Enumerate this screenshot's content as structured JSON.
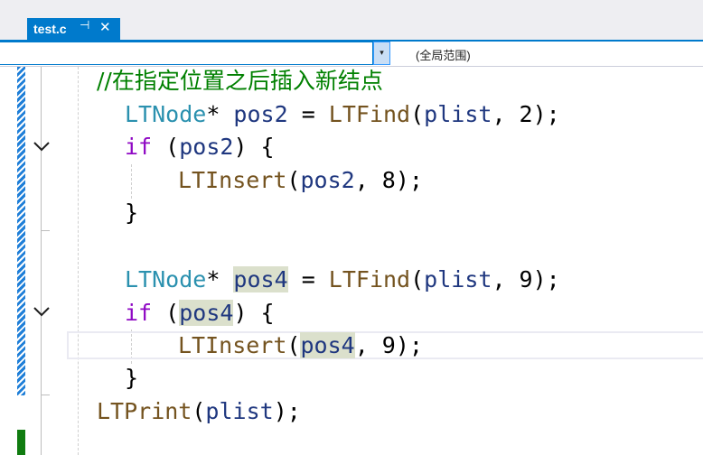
{
  "tab": {
    "filename": "test.c",
    "pin_glyph": "⊣",
    "close_glyph": "✕"
  },
  "navbar": {
    "left_value": "",
    "dropdown_glyph": "▾",
    "scope": "(全局范围)"
  },
  "code": {
    "comment": "//在指定位置之后插入新结点",
    "l1": {
      "type": "LTNode",
      "star": "* ",
      "var": "pos2",
      "eq": " = ",
      "fn": "LTFind",
      "open": "(",
      "arg": "plist",
      "rest": ", 2);"
    },
    "l2": {
      "kw": "if",
      "open": " (",
      "var": "pos2",
      "close": ") {"
    },
    "l3": {
      "fn": "LTInsert",
      "open": "(",
      "var": "pos2",
      "rest": ", 8);"
    },
    "l4": {
      "brace": "}"
    },
    "l6": {
      "type": "LTNode",
      "star": "* ",
      "var": "pos4",
      "eq": " = ",
      "fn": "LTFind",
      "open": "(",
      "arg": "plist",
      "rest": ", 9);"
    },
    "l7": {
      "kw": "if",
      "open": " (",
      "var": "pos4",
      "close": ") {"
    },
    "l8": {
      "fn": "LTInsert",
      "open": "(",
      "var": "pos4",
      "rest": ", 9);"
    },
    "l9": {
      "brace": "}"
    },
    "l10": {
      "fn": "LTPrint",
      "open": "(",
      "arg": "plist",
      "rest": ");"
    }
  }
}
